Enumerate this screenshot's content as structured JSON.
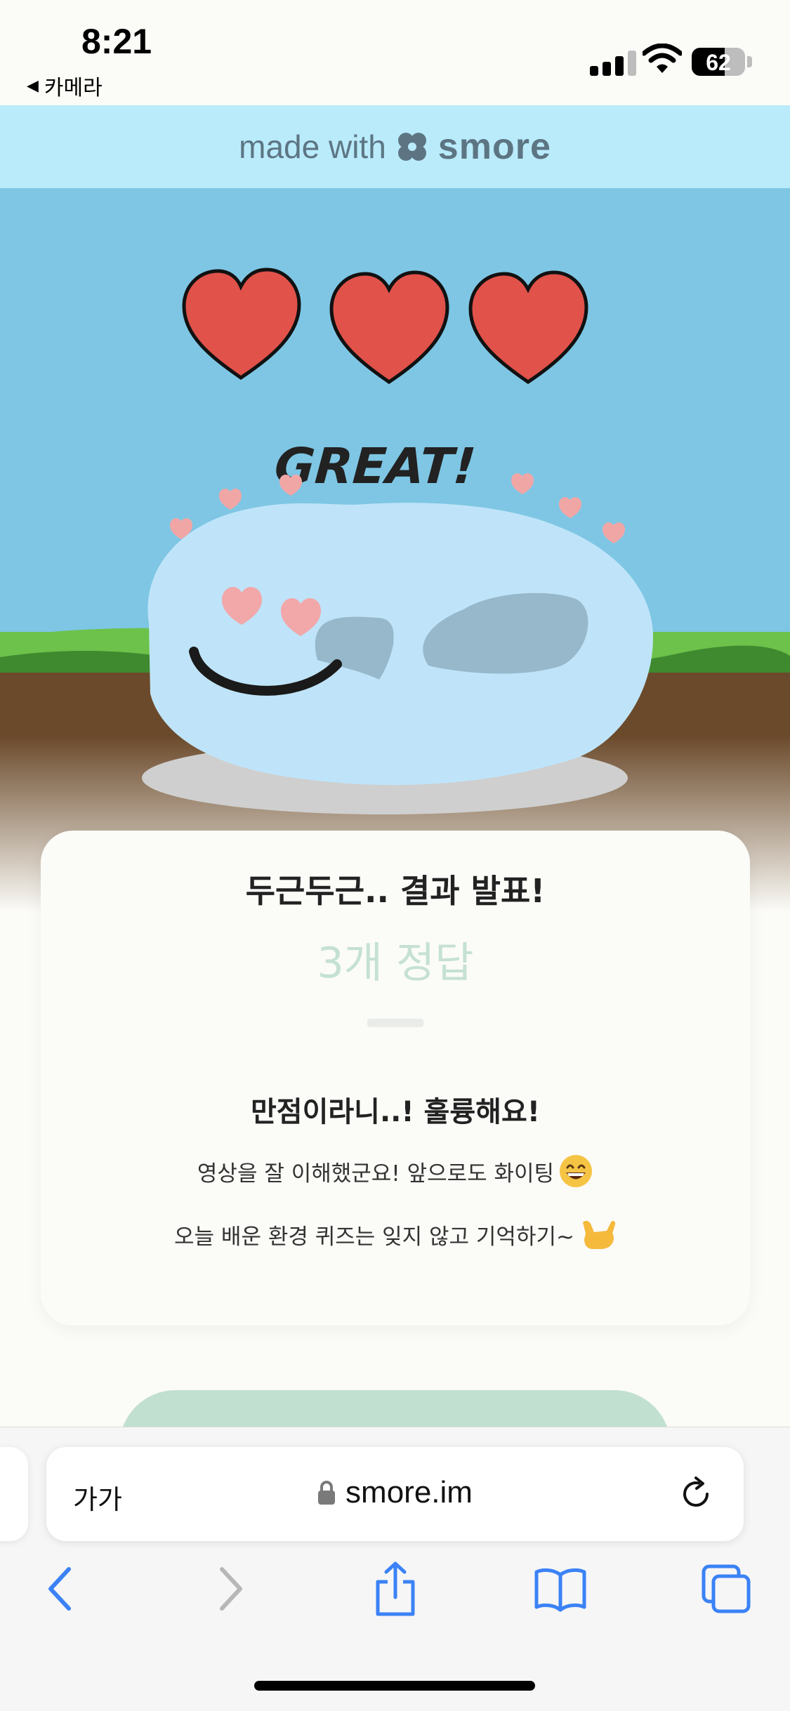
{
  "status_bar": {
    "time": "8:21",
    "back_app": "카메라",
    "battery": "62",
    "battery_level": 0.62
  },
  "banner": {
    "made_with": "made with",
    "brand": "smore"
  },
  "hero": {
    "great_text": "GREAT!",
    "hearts_count": 3,
    "colors": {
      "sky": "#7ec6e4",
      "grass": "#6cc24a",
      "soil": "#6b4a2b",
      "heart": "#e0524a"
    }
  },
  "result": {
    "heading": "두근두근.. 결과 발표!",
    "score": "3개 정답",
    "subhead": "만점이라니..! 훌륭해요!",
    "line1": "영상을 잘 이해했군요! 앞으로도 화이팅",
    "line2": "오늘 배운 환경 퀴즈는 잊지 않고 기억하기~"
  },
  "browser": {
    "text_size_button": "가가",
    "url": "smore.im"
  },
  "colors": {
    "accent_green": "#c2e0cf",
    "safari_blue": "#3b82f6"
  }
}
